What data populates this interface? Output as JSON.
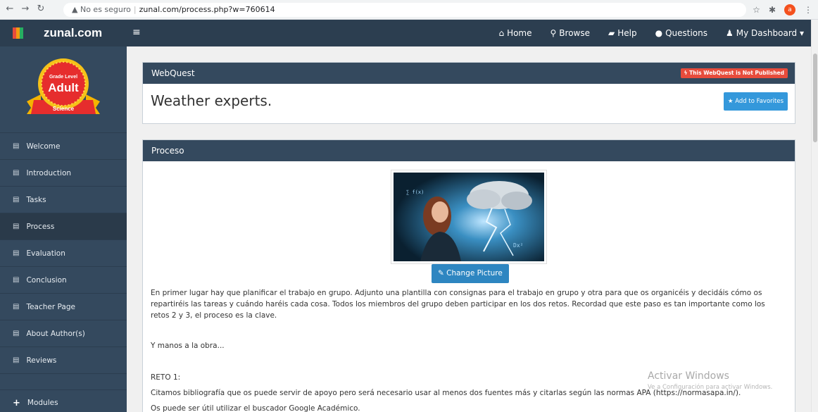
{
  "browser": {
    "insecure_label": "No es seguro",
    "url": "zunal.com/process.php?w=760614",
    "avatar_letter": "a"
  },
  "navbar": {
    "brand": "zunal.com",
    "links": [
      {
        "icon": "home-icon",
        "glyph": "⌂",
        "label": "Home"
      },
      {
        "icon": "search-icon",
        "glyph": "⚲",
        "label": "Browse"
      },
      {
        "icon": "book-icon",
        "glyph": "▰",
        "label": "Help"
      },
      {
        "icon": "comments-icon",
        "glyph": "●",
        "label": "Questions"
      },
      {
        "icon": "user-icon",
        "glyph": "♟",
        "label": "My Dashboard ▾"
      }
    ]
  },
  "badge": {
    "line1": "Grade Level",
    "line2": "Adult",
    "line3": "Science"
  },
  "sidebar": {
    "items": [
      "Welcome",
      "Introduction",
      "Tasks",
      "Process",
      "Evaluation",
      "Conclusion",
      "Teacher Page",
      "About Author(s)",
      "Reviews"
    ],
    "active_index": 3,
    "modules_label": "Modules"
  },
  "webquest_panel": {
    "heading": "WebQuest",
    "status_badge": "This WebQuest is Not Published",
    "title": "Weather experts.",
    "favorites_button": "Add to Favorites"
  },
  "process_panel": {
    "heading": "Proceso",
    "change_picture_button": "Change Picture",
    "paragraph1": "En primer lugar hay que planificar el trabajo en grupo. Adjunto una plantilla con consignas para el trabajo en grupo y otra para que os organicéis y decidáis cómo os repartiréis las tareas y cuándo haréis cada cosa. Todos los miembros del grupo deben participar en los dos retos. Recordad que este paso es tan importante como los retos 2 y 3, el proceso es la clave.",
    "paragraph2": "Y manos a la obra...",
    "paragraph3": "RETO 1:",
    "paragraph4": "Citamos bibliografía que os puede servir de apoyo pero será necesario usar al menos dos fuentes más y citarlas según las normas APA (https://normasapa.in/).",
    "paragraph5": "Os puede ser útil utilizar el buscador Google Académico."
  },
  "watermark": {
    "line1": "Activar Windows",
    "line2": "Ve a Configuración para activar Windows."
  },
  "colors": {
    "navbar": "#2c3e50",
    "sidebar": "#34495e",
    "panel_head": "#34495e",
    "primary_button": "#3498db",
    "danger_badge": "#e74c3c"
  }
}
